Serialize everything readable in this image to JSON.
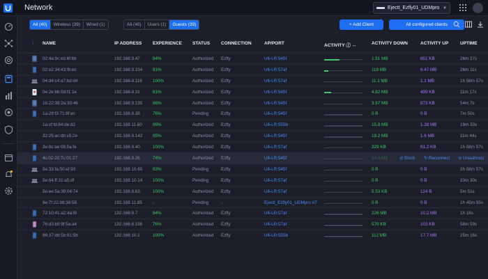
{
  "app": {
    "title": "Network",
    "site_name": "Ejectt_Ezfly01_UDMpro"
  },
  "toolbar": {
    "filter_all": "All (40)",
    "filter_wireless": "Wireless (39)",
    "filter_wired": "Wired (1)",
    "type_all": "All (40)",
    "type_users": "Users (1)",
    "type_guests": "Guests (39)",
    "add_client": "+ Add Client",
    "all_configured": "All configured clients"
  },
  "table": {
    "columns": {
      "sort": "↑",
      "name": "NAME",
      "ip": "IP ADDRESS",
      "experience": "EXPERIENCE",
      "status": "STATUS",
      "connection": "CONNECTION",
      "ap_port": "AP/PORT",
      "activity": "ACTIVITY ⓘ ↔",
      "activity_down": "ACTIVITY DOWN",
      "activity_up": "ACTIVITY UP",
      "uptime": "UPTIME"
    },
    "rows": [
      {
        "icon": "device-icon",
        "name": "02:4a:9c:eb:6f:bb",
        "ip": "192.168.9.47",
        "exp": "84%",
        "status": "Authorized",
        "conn": "Ezfly",
        "ap": "U6-LR:545f",
        "activity": 0.4,
        "down": "1.51 MB",
        "up": "851 KB",
        "uptime": "26m 27s"
      },
      {
        "icon": "phone-icon",
        "name": "02:e2:34:43:fb:ec",
        "ip": "192.168.9.154",
        "exp": "91%",
        "status": "Authorized",
        "conn": "Ezfly",
        "ap": "U6-LR:57af",
        "activity": 0.1,
        "down": "118 MB",
        "up": "6.47 MB",
        "uptime": "26m 11s"
      },
      {
        "icon": "laptop-icon",
        "name": "04:d4:c4:a7:bd:d4",
        "ip": "192.168.8.118",
        "exp": "100%",
        "status": "Authorized",
        "conn": "Ezfly",
        "ap": "U6-LR:57af",
        "activity": 0,
        "down": "11.2 MB",
        "up": "1.1 MB",
        "uptime": "1h 58m 57s"
      },
      {
        "icon": "white-device-icon",
        "name": "0e:2e:bb:5d:f1:1e",
        "ip": "192.168.8.31",
        "exp": "81%",
        "status": "Authorized",
        "conn": "Ezfly",
        "ap": "U6-LR:545f",
        "activity": 0.18,
        "down": "4.82 MB",
        "up": "499 KB",
        "uptime": "11m 17s"
      },
      {
        "icon": "device-icon",
        "name": "16:22:38:2a:30:46",
        "ip": "192.168.9.135",
        "exp": "86%",
        "status": "Authorized",
        "conn": "Ezfly",
        "ap": "U6-LR:545f",
        "activity": 0,
        "down": "3.97 MB",
        "up": "873 KB",
        "uptime": "54m 7s"
      },
      {
        "icon": "phone-icon",
        "name": "1a:29:f3:71:8f:ec",
        "ip": "192.168.8.38",
        "exp": "76%",
        "status": "Pending",
        "conn": "Ezfly",
        "ap": "U6-LR:545f",
        "activity": 0,
        "down": "0 B",
        "up": "0 B",
        "uptime": "7m 50s"
      },
      {
        "icon": "",
        "name": "1a:cf:fd:84:de:d2",
        "ip": "192.168.11.60",
        "exp": "89%",
        "status": "Authorized",
        "conn": "Ezfly",
        "ap": "U6-LR:555b",
        "activity": 0,
        "down": "15.8 MB",
        "up": "1.28 MB",
        "uptime": "19m 33s"
      },
      {
        "icon": "",
        "name": "32:25:ac:db:c5:2e",
        "ip": "192.168.9.142",
        "exp": "85%",
        "status": "Authorized",
        "conn": "Ezfly",
        "ap": "U6-LR:545f",
        "activity": 0,
        "down": "18.2 MB",
        "up": "1.6 MB",
        "uptime": "11m 44s"
      },
      {
        "icon": "phone-icon",
        "name": "3e:8c:ae:08:5a:fe",
        "ip": "192.168.9.40",
        "exp": "100%",
        "status": "Authorized",
        "conn": "Ezfly",
        "ap": "U6-LR:57af",
        "activity": 0,
        "down": "329 KB",
        "up": "61.2 KB",
        "uptime": "1h 58m 57s"
      },
      {
        "icon": "phone-icon",
        "name": "4c:02:20:7c:01:27",
        "ip": "192.168.9.26",
        "exp": "74%",
        "status": "Authorized",
        "conn": "Ezfly",
        "ap": "U6-LR:545f",
        "activity": 0,
        "down": "56.4 MB",
        "up": "",
        "uptime": "",
        "hl": true
      },
      {
        "icon": "laptop-icon",
        "name": "5e:33:fa:50:ef:93",
        "ip": "192.168.10.65",
        "exp": "83%",
        "status": "Pending",
        "conn": "Ezfly",
        "ap": "U6-LR:545f",
        "activity": 0,
        "down": "0 B",
        "up": "0 B",
        "uptime": "2h 58m 57s"
      },
      {
        "icon": "laptop-icon",
        "name": "5e:64:ff:31:a5:df",
        "ip": "192.168.10.14",
        "exp": "100%",
        "status": "Pending",
        "conn": "Ezfly",
        "ap": "U6-LR:57af",
        "activity": 0,
        "down": "0 B",
        "up": "0 B",
        "uptime": "23m 30s"
      },
      {
        "icon": "",
        "name": "5e:ee:5a:39:04:74",
        "ip": "192.168.8.63",
        "exp": "100%",
        "status": "Authorized",
        "conn": "Ezfly",
        "ap": "U6-LR:57af",
        "activity": 0,
        "down": "5.53 KB",
        "up": "124 B",
        "uptime": "5m 51s"
      },
      {
        "icon": "",
        "name": "6e:7f:22:88:38:58",
        "ip": "192.168.11.85",
        "exp": "-",
        "status": "Pending",
        "conn": "-",
        "ap": "Ejectt_Ezfly01_UDMpro #7",
        "activity": 0,
        "down": "0 B",
        "up": "0 B",
        "uptime": "1h 45m 55s"
      },
      {
        "icon": "phone-icon",
        "name": "72:10:41:a2:4a:f8",
        "ip": "192.168.9.7",
        "exp": "84%",
        "status": "Authorized",
        "conn": "Ezfly",
        "ap": "U6-LR:57af",
        "activity": 0,
        "down": "226 MB",
        "up": "10.2 MB",
        "uptime": "1h 16s"
      },
      {
        "icon": "phone-pink-icon",
        "name": "76:d3:b8:9f:5a:a4",
        "ip": "192.168.8.198",
        "exp": "76%",
        "status": "Authorized",
        "conn": "Ezfly",
        "ap": "U6-LR:57af",
        "activity": 0,
        "down": "570 KB",
        "up": "103 KB",
        "uptime": "58m 59s"
      },
      {
        "icon": "phone-icon",
        "name": "86:37:dd:5b:81:5b",
        "ip": "192.168.10.1",
        "exp": "100%",
        "status": "Authorized",
        "conn": "Ezfly",
        "ap": "U6-LR:555b",
        "activity": 0,
        "down": "112 MB",
        "up": "17.7 MB",
        "uptime": "25m 16s"
      }
    ],
    "hover_actions": {
      "block": "⊘ Block",
      "reconnect": "↻ Reconnect",
      "unauthorize": "⊖ Unauthoriz"
    }
  },
  "colors": {
    "accent": "#1e6ef2",
    "link": "#4a8df5",
    "good": "#3ec96a",
    "upload": "#a77af5"
  }
}
